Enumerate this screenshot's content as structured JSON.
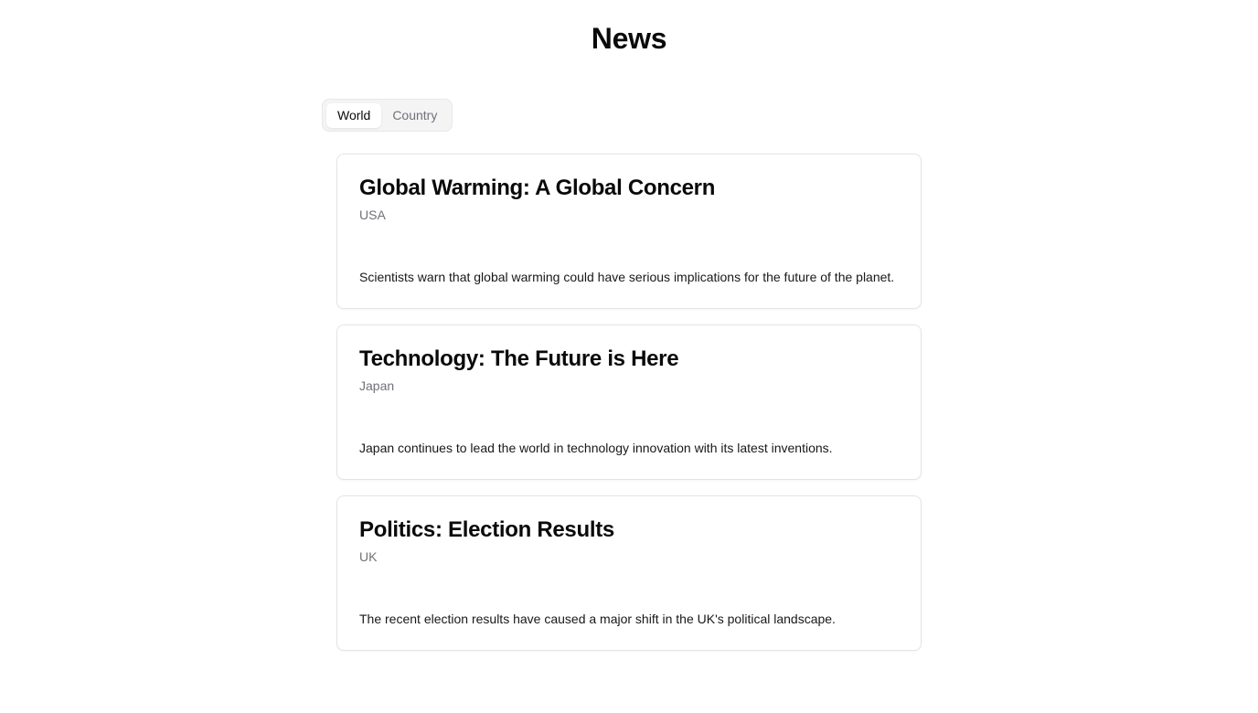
{
  "header": {
    "title": "News"
  },
  "tabs": [
    {
      "label": "World",
      "active": true
    },
    {
      "label": "Country",
      "active": false
    }
  ],
  "articles": [
    {
      "title": "Global Warming: A Global Concern",
      "country": "USA",
      "summary": "Scientists warn that global warming could have serious implications for the future of the planet."
    },
    {
      "title": "Technology: The Future is Here",
      "country": "Japan",
      "summary": "Japan continues to lead the world in technology innovation with its latest inventions."
    },
    {
      "title": "Politics: Election Results",
      "country": "UK",
      "summary": "The recent election results have caused a major shift in the UK's political landscape."
    }
  ]
}
